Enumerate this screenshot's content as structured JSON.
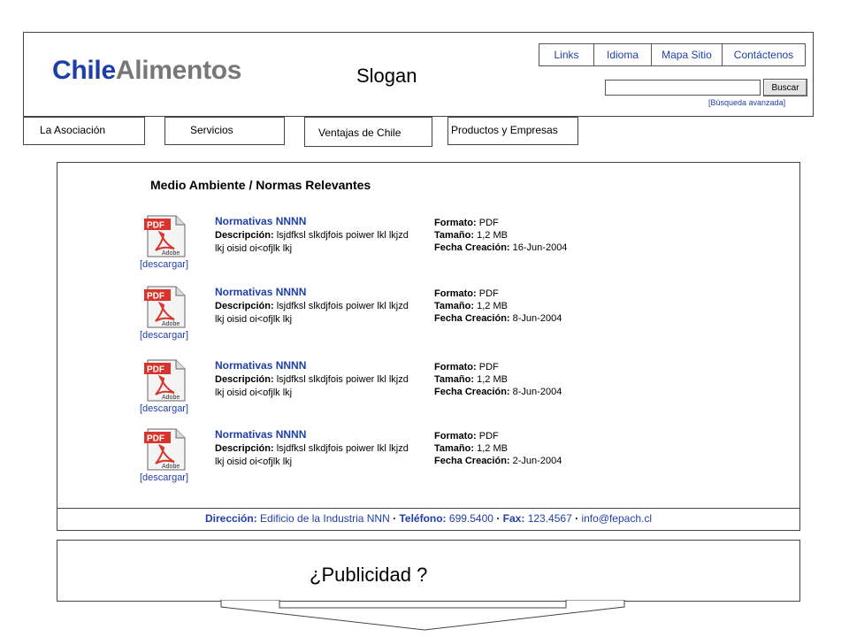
{
  "header": {
    "logo_part1": "Chile",
    "logo_part2": "Alimentos",
    "slogan": "Slogan",
    "top_links": [
      {
        "label": "Links"
      },
      {
        "label": "Idioma"
      },
      {
        "label": "Mapa Sitio"
      },
      {
        "label": "Contáctenos"
      }
    ],
    "search": {
      "value": "",
      "button_label": "Buscar",
      "advanced_link": "[Búsqueda avanzada]"
    }
  },
  "nav": {
    "items": [
      {
        "label": "La Asociación"
      },
      {
        "label": "Servicios"
      },
      {
        "label": "Ventajas de Chile"
      },
      {
        "label": "Productos y Empresas"
      }
    ]
  },
  "main": {
    "title": "Medio Ambiente  / Normas Relevantes",
    "download_label": "[descargar]",
    "desc_label": "Descripción:",
    "format_label": "Formato:",
    "size_label": "Tamaño:",
    "date_label": "Fecha Creación:",
    "documents": [
      {
        "name": "Normativas  NNNN",
        "description": "lsjdfksl slkdjfois poiwer lkl lkjzd lkj oisid oi<ofjlk lkj",
        "format": "PDF",
        "size": "1,2 MB",
        "created": "16-Jun-2004"
      },
      {
        "name": "Normativas  NNNN",
        "description": "lsjdfksl slkdjfois poiwer lkl lkjzd lkj oisid oi<ofjlk lkj",
        "format": "PDF",
        "size": "1,2 MB",
        "created": "8-Jun-2004"
      },
      {
        "name": "Normativas  NNNN",
        "description": "lsjdfksl slkdjfois poiwer lkl lkjzd lkj oisid oi<ofjlk lkj",
        "format": "PDF",
        "size": "1,2 MB",
        "created": "8-Jun-2004"
      },
      {
        "name": "Normativas  NNNN",
        "description": "lsjdfksl slkdjfois poiwer lkl lkjzd lkj oisid oi<ofjlk lkj",
        "format": "PDF",
        "size": "1,2 MB",
        "created": "2-Jun-2004"
      }
    ],
    "icon": {
      "name": "pdf-icon",
      "badge": "PDF",
      "brand": "Adobe",
      "badge_color": "#d9342b"
    }
  },
  "footer": {
    "address_label": "Dirección:",
    "address": "Edificio de la Industria NNN",
    "phone_label": "Teléfono:",
    "phone": "699.5400",
    "fax_label": "Fax:",
    "fax": "123.4567",
    "email": "info@fepach.cl",
    "separator": "·"
  },
  "ad": {
    "text": "¿Publicidad ?"
  },
  "colors": {
    "accent": "#1f3fa8",
    "logo_gray": "#777777"
  }
}
